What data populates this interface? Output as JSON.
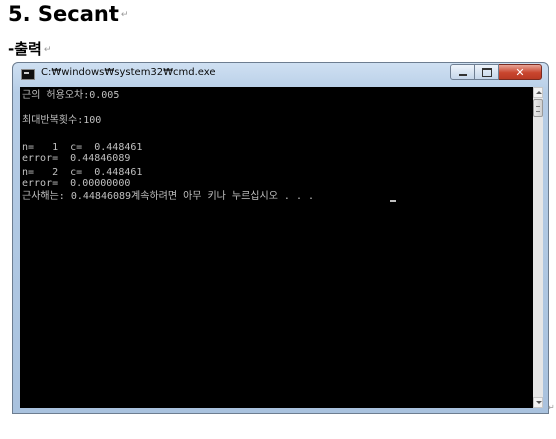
{
  "document": {
    "heading": "5. Secant",
    "subheading": "-출력",
    "para_mark": "↵"
  },
  "window": {
    "title": "C:₩windows₩system32₩cmd.exe",
    "icon": "console-icon",
    "minimize_icon": "minimize-icon",
    "maximize_icon": "maximize-icon",
    "close_glyph": "✕"
  },
  "console": {
    "text_color": "#c0c0c0",
    "background": "#000000",
    "lines": [
      "근의 허용오차:0.005",
      "",
      "최대반복횟수:100",
      "",
      "n=   1  c=  0.448461",
      "error=  0.44846089",
      "n=   2  c=  0.448461",
      "error=  0.00000000",
      "근사해는: 0.44846089계속하려면 아무 키나 누르십시오 . . ."
    ]
  }
}
